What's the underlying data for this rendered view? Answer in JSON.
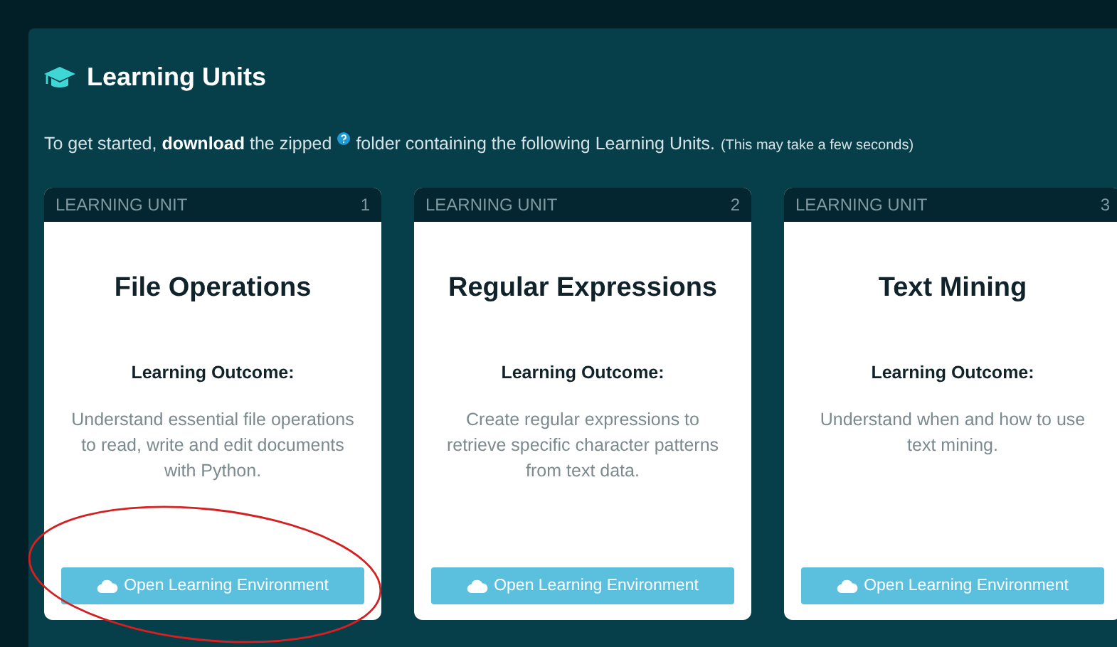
{
  "section": {
    "title": "Learning Units",
    "intro_before": "To get started, **download** the zipped",
    "intro_after": "folder containing the following Learning Units.",
    "intro_note": "(This may take a few seconds)"
  },
  "units": [
    {
      "label": "LEARNING UNIT",
      "number": "1",
      "title": "File Operations",
      "outcome_label": "Learning Outcome:",
      "outcome": "Understand essential file operations to read, write and edit documents with Python.",
      "button": "Open Learning Environment",
      "circled": true
    },
    {
      "label": "LEARNING UNIT",
      "number": "2",
      "title": "Regular Expressions",
      "outcome_label": "Learning Outcome:",
      "outcome": "Create regular expressions to retrieve specific character patterns from text data.",
      "button": "Open Learning Environment",
      "circled": false
    },
    {
      "label": "LEARNING UNIT",
      "number": "3",
      "title": "Text Mining",
      "outcome_label": "Learning Outcome:",
      "outcome": "Understand when and how to use text mining.",
      "button": "Open Learning Environment",
      "circled": false
    }
  ]
}
